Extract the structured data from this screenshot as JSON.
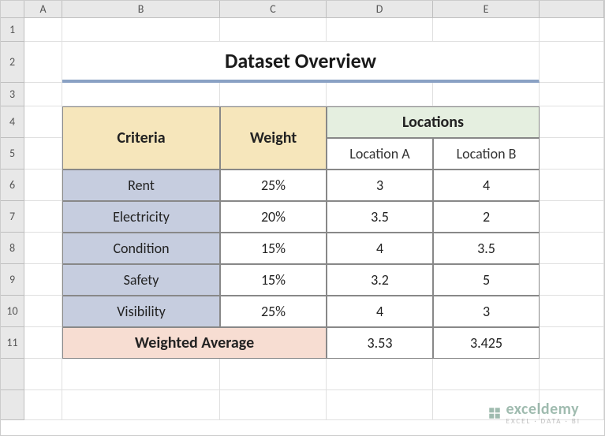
{
  "columns": [
    "A",
    "B",
    "C",
    "D",
    "E"
  ],
  "rows": [
    "1",
    "2",
    "3",
    "4",
    "5",
    "6",
    "7",
    "8",
    "9",
    "10",
    "11"
  ],
  "title": "Dataset Overview",
  "headers": {
    "criteria": "Criteria",
    "weight": "Weight",
    "locations": "Locations",
    "loc_a": "Location A",
    "loc_b": "Location B"
  },
  "table": [
    {
      "criteria": "Rent",
      "weight": "25%",
      "a": "3",
      "b": "4"
    },
    {
      "criteria": "Electricity",
      "weight": "20%",
      "a": "3.5",
      "b": "2"
    },
    {
      "criteria": "Condition",
      "weight": "15%",
      "a": "4",
      "b": "3.5"
    },
    {
      "criteria": "Safety",
      "weight": "15%",
      "a": "3.2",
      "b": "5"
    },
    {
      "criteria": "Visibility",
      "weight": "25%",
      "a": "4",
      "b": "3"
    }
  ],
  "summary": {
    "label": "Weighted Average",
    "a": "3.53",
    "b": "3.425"
  },
  "watermark": {
    "brand": "exceldemy",
    "tag": "EXCEL · DATA · BI"
  },
  "chart_data": {
    "type": "table",
    "title": "Dataset Overview",
    "columns": [
      "Criteria",
      "Weight",
      "Location A",
      "Location B"
    ],
    "rows": [
      [
        "Rent",
        0.25,
        3,
        4
      ],
      [
        "Electricity",
        0.2,
        3.5,
        2
      ],
      [
        "Condition",
        0.15,
        4,
        3.5
      ],
      [
        "Safety",
        0.15,
        3.2,
        5
      ],
      [
        "Visibility",
        0.25,
        4,
        3
      ]
    ],
    "summary": {
      "label": "Weighted Average",
      "Location A": 3.53,
      "Location B": 3.425
    }
  }
}
